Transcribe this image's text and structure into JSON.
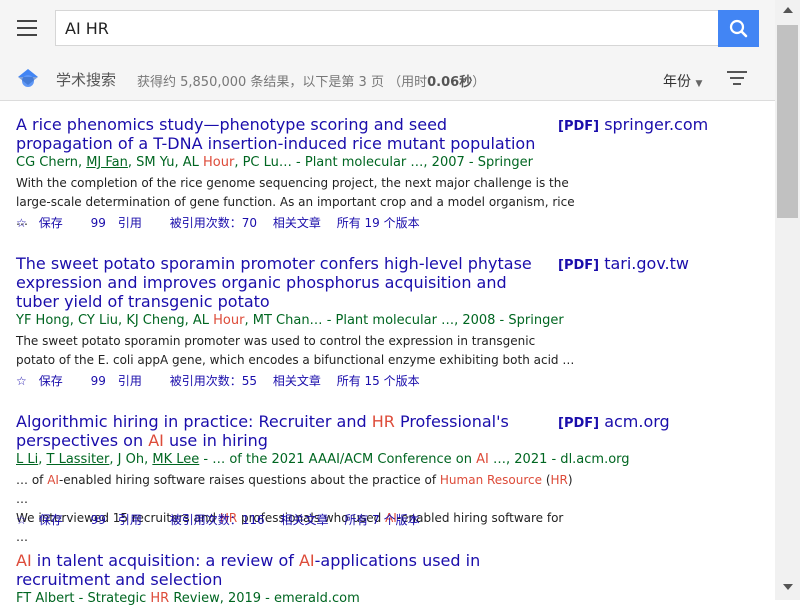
{
  "search": {
    "query": "AI HR"
  },
  "subheader": {
    "brand": "学术搜索",
    "stats_prefix": "获得约 5,850,000 条结果，以下是第 3 页",
    "time_open": "（用时",
    "time_value": "0.06秒",
    "time_close": "）",
    "year_label": "年份"
  },
  "actions": {
    "save": "保存",
    "cite": "引用",
    "related": "相关文章"
  },
  "results": [
    {
      "title": "A rice phenomics study—phenotype scoring and seed propagation of a T-DNA insertion-induced rice mutant population",
      "pdf_tag": "[PDF]",
      "pdf_source": "springer.com",
      "authors_a": "CG Chern, ",
      "authors_link": "MJ Fan",
      "authors_b": ", SM Yu, AL ",
      "authors_hl": "Hour",
      "authors_c": ", PC Lu… - Plant molecular …, 2007 - Springer",
      "snippet_1": "With the completion of the rice genome sequencing project, the next major challenge is the",
      "snippet_2": "large-scale determination of gene function. As an important crop and a model organism, rice …",
      "cited_by": "被引用次数：70",
      "versions": "所有 19 个版本"
    },
    {
      "title": "The sweet potato sporamin promoter confers high-level phytase expression and improves organic phosphorus acquisition and tuber yield of transgenic potato",
      "pdf_tag": "[PDF]",
      "pdf_source": "tari.gov.tw",
      "authors_a": "YF Hong, CY Liu, KJ Cheng, AL ",
      "authors_hl": "Hour",
      "authors_c": ", MT Chan… - Plant molecular …, 2008 - Springer",
      "snippet_1": "The sweet potato sporamin promoter was used to control the expression in transgenic",
      "snippet_2": "potato of the E. coli appA gene, which encodes a bifunctional enzyme exhibiting both acid …",
      "cited_by": "被引用次数：55",
      "versions": "所有 15 个版本"
    },
    {
      "title_a": "Algorithmic hiring in practice: Recruiter and ",
      "title_hl1": "HR",
      "title_b": " Professional's perspectives on ",
      "title_hl2": "AI",
      "title_c": " use in hiring",
      "pdf_tag": "[PDF]",
      "pdf_source": "acm.org",
      "authors_l1": "L Li",
      "authors_s1": ", ",
      "authors_l2": "T Lassiter",
      "authors_s2": ", J Oh, ",
      "authors_l3": "MK Lee",
      "authors_s3": " - … of the 2021 AAAI/ACM Conference on ",
      "authors_hl": "AI",
      "authors_s4": " …, 2021 - dl.acm.org",
      "snip1_a": "… of ",
      "snip1_hl1": "AI",
      "snip1_b": "-enabled hiring software raises questions about the practice of ",
      "snip1_hl2": "Human Resource",
      "snip1_c": " (",
      "snip1_hl3": "HR",
      "snip1_d": ") …",
      "snip2_a": "We interviewed 15 recruiters and ",
      "snip2_hl1": "HR",
      "snip2_b": " professionals who used ",
      "snip2_hl2": "AI",
      "snip2_c": "-enabled hiring software for …",
      "cited_by": "被引用次数：116",
      "versions": "所有 7 个版本"
    },
    {
      "title_hl1": "AI",
      "title_a": " in talent acquisition: a review of ",
      "title_hl2": "AI",
      "title_b": "-applications used in recruitment and selection",
      "authors_a": "FT Albert - Strategic ",
      "authors_hl": "HR",
      "authors_b": " Review, 2019 - emerald.com"
    }
  ]
}
